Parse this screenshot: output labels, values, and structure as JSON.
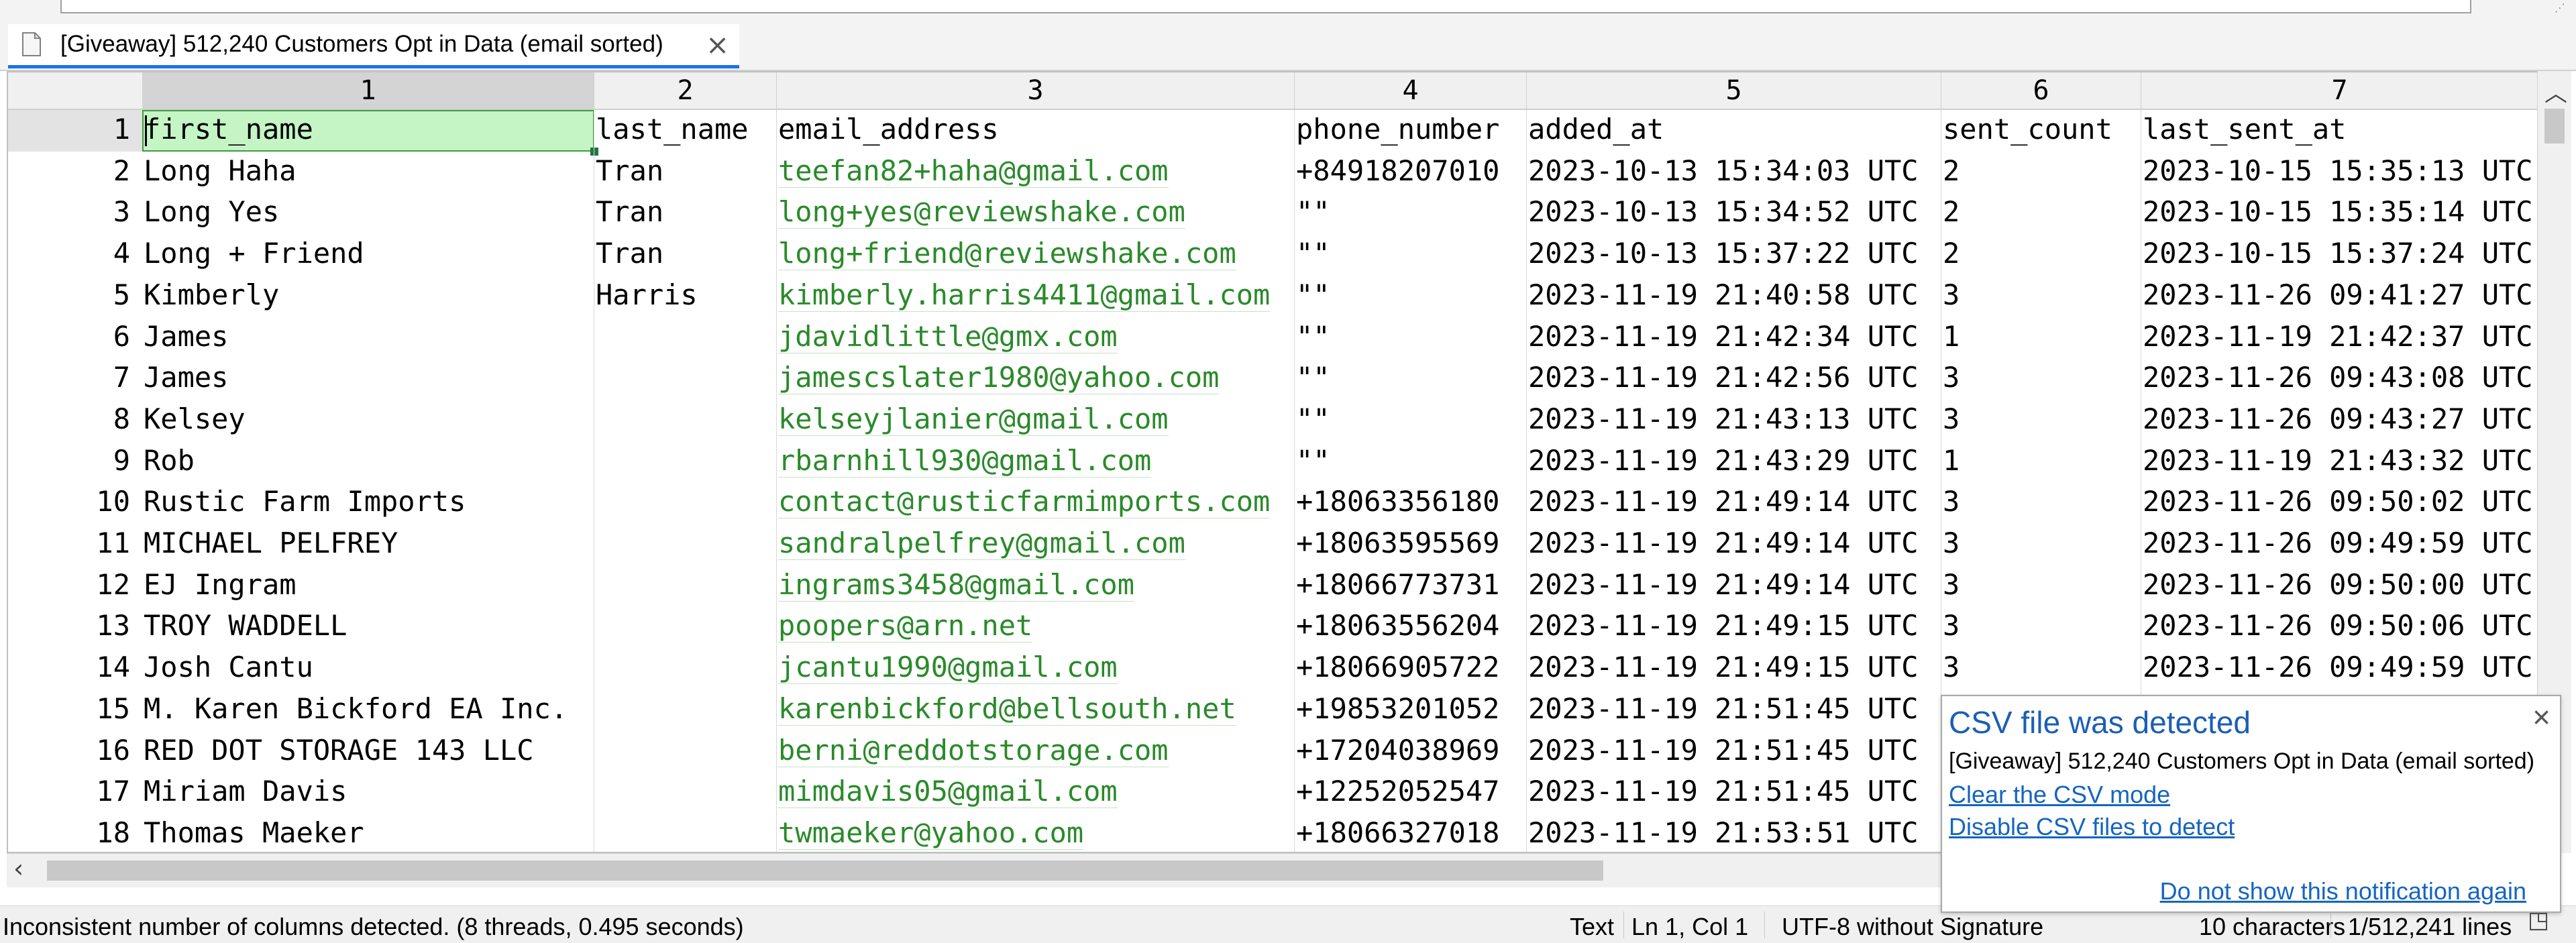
{
  "tab": {
    "title": "[Giveaway] 512,240 Customers Opt in Data (email sorted)",
    "icon": "document-icon"
  },
  "column_headers": [
    "1",
    "2",
    "3",
    "4",
    "5",
    "6",
    "7"
  ],
  "rows": [
    {
      "ln": "1",
      "first": "first_name",
      "last": "last_name",
      "email": "email_address",
      "phone": "phone_number",
      "added": "added_at",
      "sent": "sent_count",
      "last_sent": "last_sent_at"
    },
    {
      "ln": "2",
      "first": "Long Haha",
      "last": "Tran",
      "email": "teefan82+haha@gmail.com",
      "phone": "+84918207010",
      "added": "2023-10-13 15:34:03 UTC",
      "sent": "2",
      "last_sent": "2023-10-15 15:35:13 UTC"
    },
    {
      "ln": "3",
      "first": "Long Yes",
      "last": "Tran",
      "email": "long+yes@reviewshake.com",
      "phone": "\"\"",
      "added": "2023-10-13 15:34:52 UTC",
      "sent": "2",
      "last_sent": "2023-10-15 15:35:14 UTC"
    },
    {
      "ln": "4",
      "first": "Long + Friend",
      "last": "Tran",
      "email": "long+friend@reviewshake.com",
      "phone": "\"\"",
      "added": "2023-10-13 15:37:22 UTC",
      "sent": "2",
      "last_sent": "2023-10-15 15:37:24 UTC"
    },
    {
      "ln": "5",
      "first": "Kimberly",
      "last": "Harris",
      "email": "kimberly.harris4411@gmail.com",
      "phone": "\"\"",
      "added": "2023-11-19 21:40:58 UTC",
      "sent": "3",
      "last_sent": "2023-11-26 09:41:27 UTC"
    },
    {
      "ln": "6",
      "first": "James",
      "last": "",
      "email": "jdavidlittle@gmx.com",
      "phone": "\"\"",
      "added": "2023-11-19 21:42:34 UTC",
      "sent": "1",
      "last_sent": "2023-11-19 21:42:37 UTC"
    },
    {
      "ln": "7",
      "first": "James",
      "last": "",
      "email": "jamescslater1980@yahoo.com",
      "phone": "\"\"",
      "added": "2023-11-19 21:42:56 UTC",
      "sent": "3",
      "last_sent": "2023-11-26 09:43:08 UTC"
    },
    {
      "ln": "8",
      "first": "Kelsey",
      "last": "",
      "email": "kelseyjlanier@gmail.com",
      "phone": "\"\"",
      "added": "2023-11-19 21:43:13 UTC",
      "sent": "3",
      "last_sent": "2023-11-26 09:43:27 UTC"
    },
    {
      "ln": "9",
      "first": "Rob",
      "last": "",
      "email": "rbarnhill930@gmail.com",
      "phone": "\"\"",
      "added": "2023-11-19 21:43:29 UTC",
      "sent": "1",
      "last_sent": "2023-11-19 21:43:32 UTC"
    },
    {
      "ln": "10",
      "first": "Rustic Farm Imports",
      "last": "",
      "email": "contact@rusticfarmimports.com",
      "phone": "+18063356180",
      "added": "2023-11-19 21:49:14 UTC",
      "sent": "3",
      "last_sent": "2023-11-26 09:50:02 UTC"
    },
    {
      "ln": "11",
      "first": "MICHAEL PELFREY",
      "last": "",
      "email": "sandralpelfrey@gmail.com",
      "phone": "+18063595569",
      "added": "2023-11-19 21:49:14 UTC",
      "sent": "3",
      "last_sent": "2023-11-26 09:49:59 UTC"
    },
    {
      "ln": "12",
      "first": "EJ Ingram",
      "last": "",
      "email": "ingrams3458@gmail.com",
      "phone": "+18066773731",
      "added": "2023-11-19 21:49:14 UTC",
      "sent": "3",
      "last_sent": "2023-11-26 09:50:00 UTC"
    },
    {
      "ln": "13",
      "first": "TROY WADDELL",
      "last": "",
      "email": "poopers@arn.net",
      "phone": "+18063556204",
      "added": "2023-11-19 21:49:15 UTC",
      "sent": "3",
      "last_sent": "2023-11-26 09:50:06 UTC"
    },
    {
      "ln": "14",
      "first": "Josh Cantu",
      "last": "",
      "email": "jcantu1990@gmail.com",
      "phone": "+18066905722",
      "added": "2023-11-19 21:49:15 UTC",
      "sent": "3",
      "last_sent": "2023-11-26 09:49:59 UTC"
    },
    {
      "ln": "15",
      "first": "M. Karen Bickford EA Inc.",
      "last": "",
      "email": "karenbickford@bellsouth.net",
      "phone": "+19853201052",
      "added": "2023-11-19 21:51:45 UTC",
      "sent": "",
      "last_sent": ""
    },
    {
      "ln": "16",
      "first": "RED DOT STORAGE 143 LLC",
      "last": "",
      "email": "berni@reddotstorage.com",
      "phone": "+17204038969",
      "added": "2023-11-19 21:51:45 UTC",
      "sent": "",
      "last_sent": ""
    },
    {
      "ln": "17",
      "first": "Miriam Davis",
      "last": "",
      "email": "mimdavis05@gmail.com",
      "phone": "+12252052547",
      "added": "2023-11-19 21:51:45 UTC",
      "sent": "",
      "last_sent": ""
    },
    {
      "ln": "18",
      "first": "Thomas Maeker",
      "last": "",
      "email": "twmaeker@yahoo.com",
      "phone": "+18066327018",
      "added": "2023-11-19 21:53:51 UTC",
      "sent": "",
      "last_sent": ""
    }
  ],
  "status": {
    "message": "Inconsistent number of columns detected. (8 threads, 0.495 seconds)",
    "mode": "Text",
    "position": "Ln 1, Col 1",
    "encoding": "UTF-8 without Signature",
    "chars": "10 characters",
    "lines": "1/512,241 lines"
  },
  "popup": {
    "title": "CSV file was detected",
    "file": "[Giveaway] 512,240 Customers Opt in Data (email sorted)",
    "link_clear": "Clear the CSV mode",
    "link_disable": "Disable CSV files to detect",
    "link_dont_show": "Do not show this notification again"
  },
  "colors": {
    "email": "#2a8a2a",
    "selected_cell": "#c5f5c5",
    "link": "#1565c0",
    "popup_title": "#1a5fb4",
    "tab_accent": "#1a73e8"
  }
}
